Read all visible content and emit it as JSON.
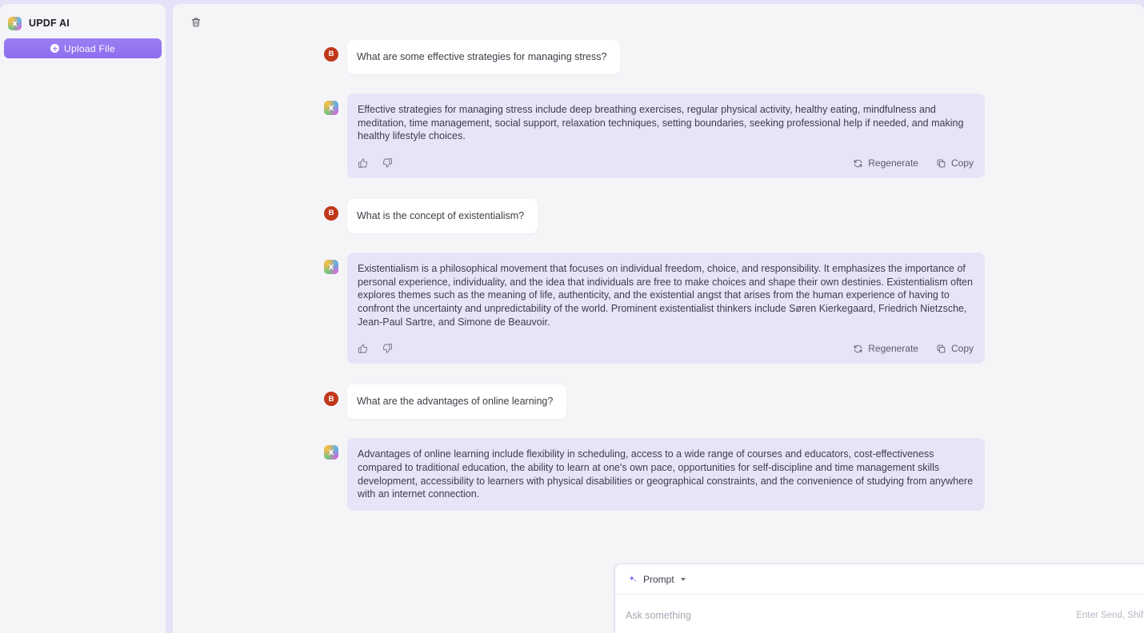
{
  "sidebar": {
    "brand_title": "UPDF AI",
    "brand_logo_icon": "updf-logo-icon",
    "upload_button": {
      "label": "Upload File",
      "icon": "plus-circle-icon"
    }
  },
  "toolbar": {
    "delete_icon": "trash-icon",
    "delete_title": "Delete"
  },
  "colors": {
    "accent": "#8f6df0",
    "ai_bubble": "#e7e4f7",
    "user_avatar": "#c0381a",
    "app_background": "#e4e3f7",
    "panel_background": "#f5f5f8"
  },
  "conversation": [
    {
      "role": "user",
      "avatar_letter": "B",
      "text": "What are some effective strategies for managing stress?"
    },
    {
      "role": "assistant",
      "avatar_icon": "updf-ai-icon",
      "text": "Effective strategies for managing stress include deep breathing exercises, regular physical activity, healthy eating, mindfulness and meditation, time management, social support, relaxation techniques, setting boundaries, seeking professional help if needed, and making healthy lifestyle choices.",
      "actions": {
        "thumbs_up_icon": "thumbs-up-icon",
        "thumbs_down_icon": "thumbs-down-icon",
        "regenerate_label": "Regenerate",
        "regenerate_icon": "refresh-icon",
        "copy_label": "Copy",
        "copy_icon": "copy-icon"
      }
    },
    {
      "role": "user",
      "avatar_letter": "B",
      "text": "What is the concept of existentialism?"
    },
    {
      "role": "assistant",
      "avatar_icon": "updf-ai-icon",
      "text": "Existentialism is a philosophical movement that focuses on individual freedom, choice, and responsibility. It emphasizes the importance of personal experience, individuality, and the idea that individuals are free to make choices and shape their own destinies. Existentialism often explores themes such as the meaning of life, authenticity, and the existential angst that arises from the human experience of having to confront the uncertainty and unpredictability of the world. Prominent existentialist thinkers include Søren Kierkegaard, Friedrich Nietzsche, Jean-Paul Sartre, and Simone de Beauvoir.",
      "actions": {
        "thumbs_up_icon": "thumbs-up-icon",
        "thumbs_down_icon": "thumbs-down-icon",
        "regenerate_label": "Regenerate",
        "regenerate_icon": "refresh-icon",
        "copy_label": "Copy",
        "copy_icon": "copy-icon"
      }
    },
    {
      "role": "user",
      "avatar_letter": "B",
      "text": "What are the advantages of online learning?"
    },
    {
      "role": "assistant",
      "avatar_icon": "updf-ai-icon",
      "text": "Advantages of online learning include flexibility in scheduling, access to a wide range of courses and educators, cost-effectiveness compared to traditional education, the ability to learn at one's own pace, opportunities for self-discipline and time management skills development, accessibility to learners with physical disabilities or geographical constraints, and the convenience of studying from anywhere with an internet connection.",
      "actions": null
    }
  ],
  "composer": {
    "prompt_chip_label": "Prompt",
    "prompt_chip_icon": "sparkle-icon",
    "prompt_chip_caret": "chevron-down-icon",
    "input_placeholder": "Ask something",
    "input_value": "",
    "send_hint": "Enter Send, Shift + Enter Newline",
    "send_icon": "send-icon"
  }
}
